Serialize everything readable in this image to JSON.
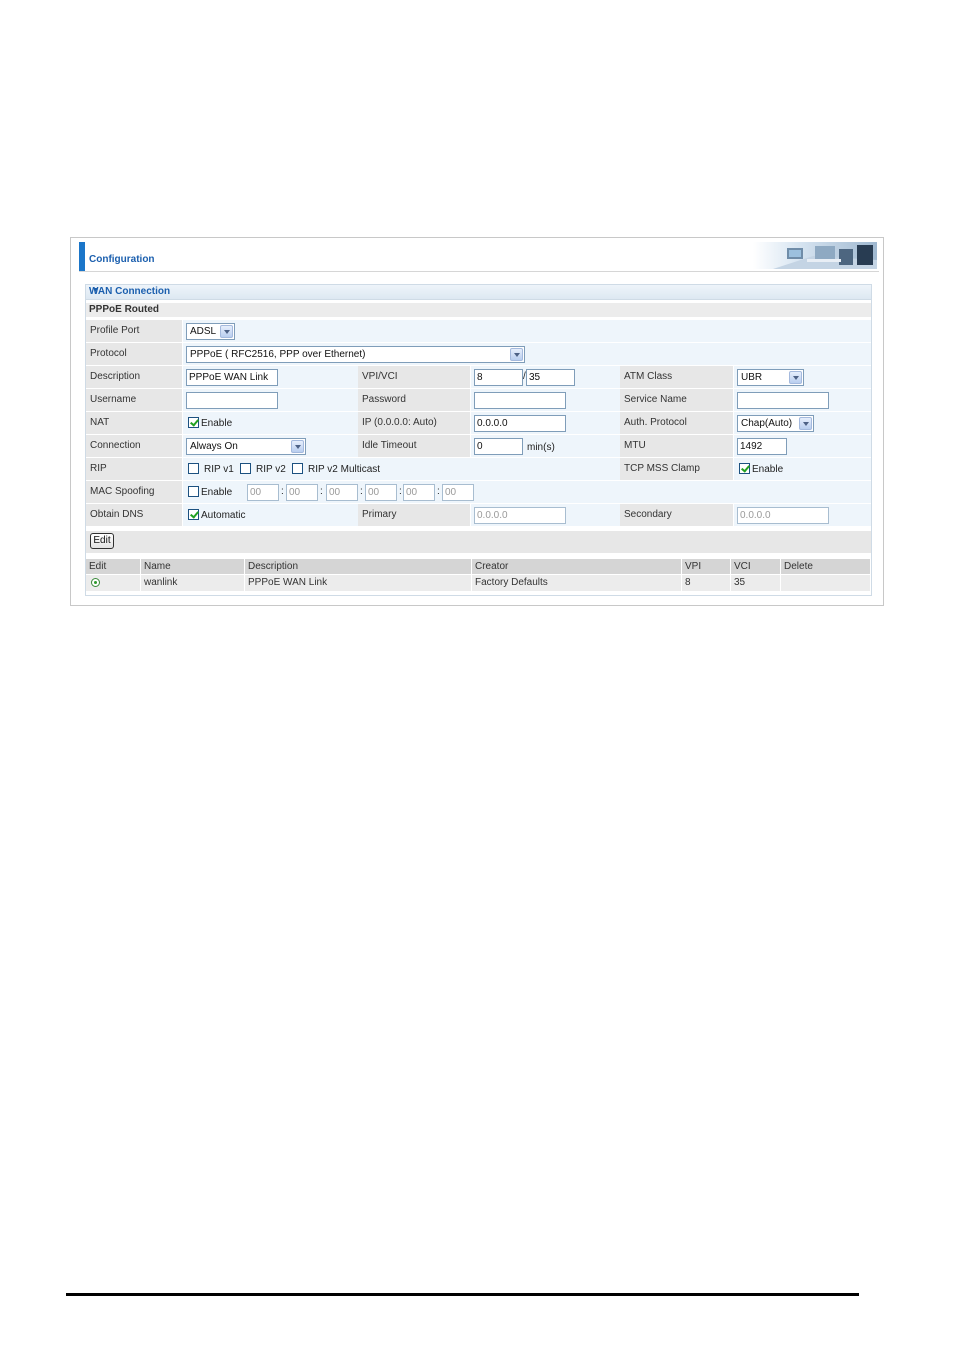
{
  "header": {
    "title": "Configuration"
  },
  "wan": {
    "title": "WAN Connection",
    "section": "PPPoE Routed",
    "profile_port": {
      "label": "Profile Port",
      "value": "ADSL"
    },
    "protocol": {
      "label": "Protocol",
      "value": "PPPoE ( RFC2516, PPP over Ethernet)"
    },
    "description": {
      "label": "Description",
      "value": "PPPoE WAN Link"
    },
    "vpi_vci": {
      "label": "VPI/VCI",
      "vpi": "8",
      "separator": "/",
      "vci": "35"
    },
    "atm_class": {
      "label": "ATM Class",
      "value": "UBR"
    },
    "username": {
      "label": "Username",
      "value": ""
    },
    "password": {
      "label": "Password",
      "value": ""
    },
    "service_name": {
      "label": "Service Name",
      "value": ""
    },
    "nat": {
      "label": "NAT",
      "checkbox_label": "Enable",
      "checked": true
    },
    "ip": {
      "label": "IP (0.0.0.0: Auto)",
      "value": "0.0.0.0"
    },
    "auth_protocol": {
      "label": "Auth. Protocol",
      "value": "Chap(Auto)"
    },
    "connection": {
      "label": "Connection",
      "value": "Always On"
    },
    "idle_timeout": {
      "label": "Idle Timeout",
      "value": "0",
      "unit": "min(s)"
    },
    "mtu": {
      "label": "MTU",
      "value": "1492"
    },
    "rip": {
      "label": "RIP",
      "v1": "RIP v1",
      "v2": "RIP v2",
      "v2m": "RIP v2 Multicast"
    },
    "tcp_mss": {
      "label": "TCP MSS Clamp",
      "checkbox_label": "Enable",
      "checked": true
    },
    "mac_spoofing": {
      "label": "MAC Spoofing",
      "checkbox_label": "Enable",
      "octets": [
        "00",
        "00",
        "00",
        "00",
        "00",
        "00"
      ],
      "separator": ":"
    },
    "obtain_dns": {
      "label": "Obtain DNS",
      "checkbox_label": "Automatic",
      "checked": true
    },
    "primary": {
      "label": "Primary",
      "value": "0.0.0.0"
    },
    "secondary": {
      "label": "Secondary",
      "value": "0.0.0.0"
    },
    "edit_button": "Edit"
  },
  "table": {
    "columns": [
      "Edit",
      "Name",
      "Description",
      "Creator",
      "VPI",
      "VCI",
      "Delete"
    ],
    "rows": [
      {
        "name": "wanlink",
        "description": "PPPoE WAN Link",
        "creator": "Factory Defaults",
        "vpi": "8",
        "vci": "35"
      }
    ]
  }
}
